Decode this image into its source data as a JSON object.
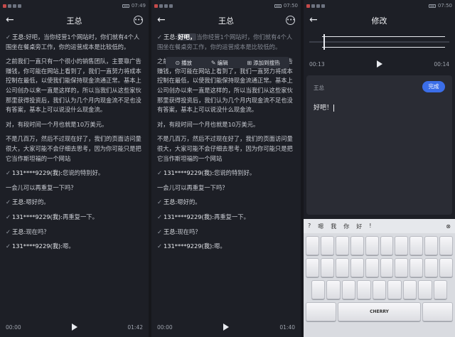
{
  "status": {
    "time1": "07:49",
    "time2": "07:50",
    "time3": "07:50"
  },
  "panel1": {
    "title": "王总",
    "paragraphs": [
      {
        "speaker": "王总:",
        "text": "好吧，当你经营1个网站时，你们就有4个人围坐在餐桌旁工作，你的运营成本是比较低的。"
      },
      {
        "speaker": "",
        "text": "之前我们一直只有一个很小的销售团队，主要靠广告赚钱，你可能在网站上看到了，我们一直努力将成本控制在最低，以使我们能保持现金流通正常。基本上公司创办以来一直是这样的，所以当我们从这些家伙那里获得投资后，我们认为几个月内现金流不足也没有答案，基本上可以说没什么现金流。"
      },
      {
        "speaker": "",
        "text": "对，有段时间一个月也就是10万美元。"
      },
      {
        "speaker": "",
        "text": "不是几百万，然后不过现在好了，我们的页面访问量很大，大家可能不会仔细去思考，因为你可能只是把它当作斯坦福的一个网站"
      },
      {
        "speaker": "131****9229(我):",
        "text": "您说的特别好。"
      },
      {
        "speaker": "",
        "text": "一会儿可以再重复一下吗？"
      },
      {
        "speaker": "王总:",
        "text": "嗯好的。"
      },
      {
        "speaker": "131****9229(我):",
        "text": "再重复一下。"
      },
      {
        "speaker": "王总:",
        "text": "现在吗？"
      },
      {
        "speaker": "131****9229(我):",
        "text": "嗯。"
      }
    ],
    "time_current": "00:00",
    "time_total": "01:42"
  },
  "panel2": {
    "title": "王总",
    "highlight": "好吧，",
    "first_rest": "当你经营1个网站时，你们就有4个人围坐在餐桌旁工作，你的运营成本是比较低的。",
    "menu": {
      "play": "播放",
      "edit": "编辑",
      "add_hot": "添加到搜热"
    },
    "time_current": "00:00",
    "time_total": "01:40"
  },
  "panel3": {
    "title": "修改",
    "time_start": "00:13",
    "time_end": "00:14",
    "speaker": "王总",
    "done_label": "完成",
    "edit_text": "好吧！",
    "candidates": [
      "?",
      "嗯",
      "我",
      "你",
      "好",
      "!"
    ],
    "brand": "CHERRY"
  }
}
